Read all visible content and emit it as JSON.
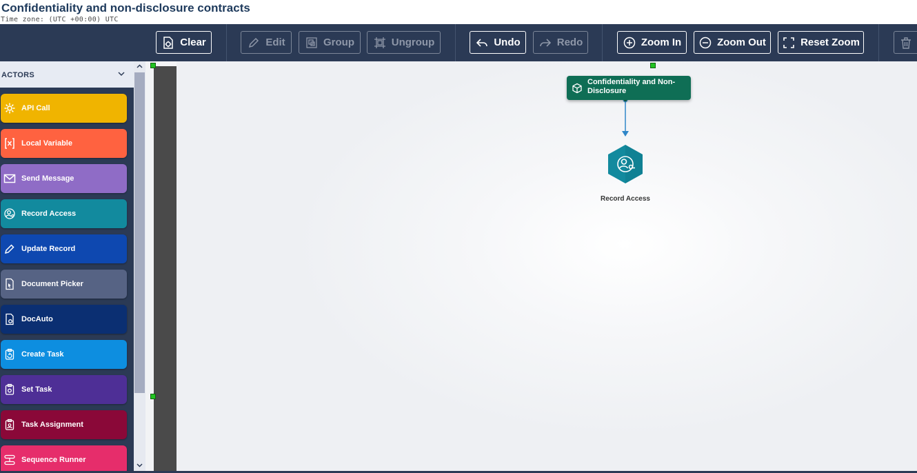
{
  "page": {
    "title": "Confidentiality and non-disclosure contracts",
    "timezone": "Time zone: (UTC +00:00) UTC"
  },
  "toolbar": {
    "clear": "Clear",
    "edit": "Edit",
    "group": "Group",
    "ungroup": "Ungroup",
    "undo": "Undo",
    "redo": "Redo",
    "zoom_in": "Zoom In",
    "zoom_out": "Zoom Out",
    "reset_zoom": "Reset Zoom"
  },
  "sidebar": {
    "header": "ACTORS",
    "actors": [
      {
        "label": "API Call",
        "color": "#f0b400",
        "icon": "gear-icon"
      },
      {
        "label": "Local Variable",
        "color": "#ff6240",
        "icon": "variable-icon"
      },
      {
        "label": "Send Message",
        "color": "#8f6cc6",
        "icon": "envelope-icon"
      },
      {
        "label": "Record Access",
        "color": "#128a9e",
        "icon": "record-access-icon"
      },
      {
        "label": "Update Record",
        "color": "#0e48b0",
        "icon": "pencil-icon"
      },
      {
        "label": "Document Picker",
        "color": "#566384",
        "icon": "document-picker-icon"
      },
      {
        "label": "DocAuto",
        "color": "#0b2f72",
        "icon": "doc-gear-icon"
      },
      {
        "label": "Create Task",
        "color": "#0d8ee0",
        "icon": "create-task-icon"
      },
      {
        "label": "Set Task",
        "color": "#4e2f96",
        "icon": "set-task-icon"
      },
      {
        "label": "Task Assignment",
        "color": "#8a0838",
        "icon": "task-assignment-icon"
      },
      {
        "label": "Sequence Runner",
        "color": "#e62d6b",
        "icon": "sequence-icon"
      }
    ]
  },
  "canvas": {
    "start_node": {
      "label": "Confidentiality and Non-Disclosure",
      "color": "#0f6e55"
    },
    "record_node": {
      "label": "Record Access",
      "color": "#128a9e"
    }
  }
}
